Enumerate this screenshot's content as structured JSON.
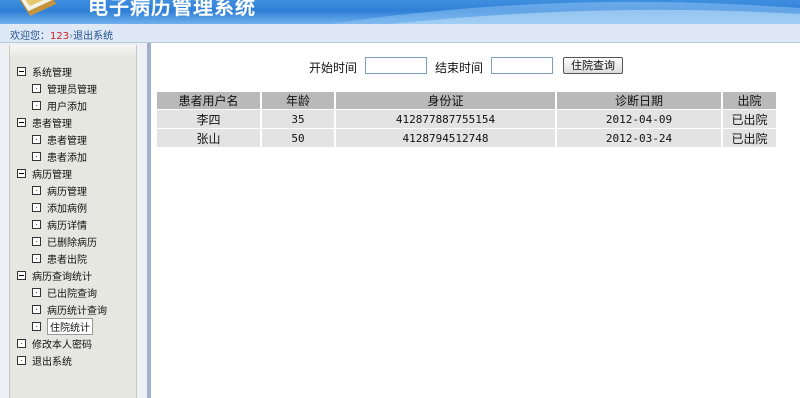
{
  "header": {
    "title": "电子病历管理系统",
    "colors": {
      "header_blue": "#2f7fd6",
      "welcome_bg": "#dfe9f5",
      "table_header": "#b9b9b9",
      "table_row": "#e3e3e3"
    }
  },
  "welcome": {
    "greeting": "欢迎您：",
    "username": "123",
    "separator": "›",
    "logout": "退出系统"
  },
  "menu": {
    "items": [
      {
        "label": "系统管理",
        "level": 0,
        "icon": "collapse-icon"
      },
      {
        "label": "管理员管理",
        "level": 1,
        "icon": "leaf-icon"
      },
      {
        "label": "用户添加",
        "level": 1,
        "icon": "leaf-icon"
      },
      {
        "label": "患者管理",
        "level": 0,
        "icon": "collapse-icon"
      },
      {
        "label": "患者管理",
        "level": 1,
        "icon": "leaf-icon"
      },
      {
        "label": "患者添加",
        "level": 1,
        "icon": "leaf-icon"
      },
      {
        "label": "病历管理",
        "level": 0,
        "icon": "collapse-icon"
      },
      {
        "label": "病历管理",
        "level": 1,
        "icon": "leaf-icon"
      },
      {
        "label": "添加病例",
        "level": 1,
        "icon": "leaf-icon"
      },
      {
        "label": "病历详情",
        "level": 1,
        "icon": "leaf-icon"
      },
      {
        "label": "已删除病历",
        "level": 1,
        "icon": "leaf-icon"
      },
      {
        "label": "患者出院",
        "level": 1,
        "icon": "leaf-icon"
      },
      {
        "label": "病历查询统计",
        "level": 0,
        "icon": "collapse-icon"
      },
      {
        "label": "已出院查询",
        "level": 1,
        "icon": "leaf-icon"
      },
      {
        "label": "病历统计查询",
        "level": 1,
        "icon": "leaf-icon"
      },
      {
        "label": "住院统计",
        "level": 1,
        "icon": "leaf-icon",
        "selected": true
      },
      {
        "label": "修改本人密码",
        "level": 0,
        "icon": "leaf-icon"
      },
      {
        "label": "退出系统",
        "level": 0,
        "icon": "leaf-icon"
      }
    ]
  },
  "query": {
    "start_label": "开始时间",
    "start_value": "",
    "end_label": "结束时间",
    "end_value": "",
    "button_label": "住院查询"
  },
  "table": {
    "columns": [
      "患者用户名",
      "年龄",
      "身份证",
      "诊断日期",
      "出院"
    ],
    "rows": [
      {
        "name": "李四",
        "age": "35",
        "id_card": "412877887755154",
        "date": "2012-04-09",
        "status": "已出院"
      },
      {
        "name": "张山",
        "age": "50",
        "id_card": "4128794512748",
        "date": "2012-03-24",
        "status": "已出院"
      }
    ]
  }
}
